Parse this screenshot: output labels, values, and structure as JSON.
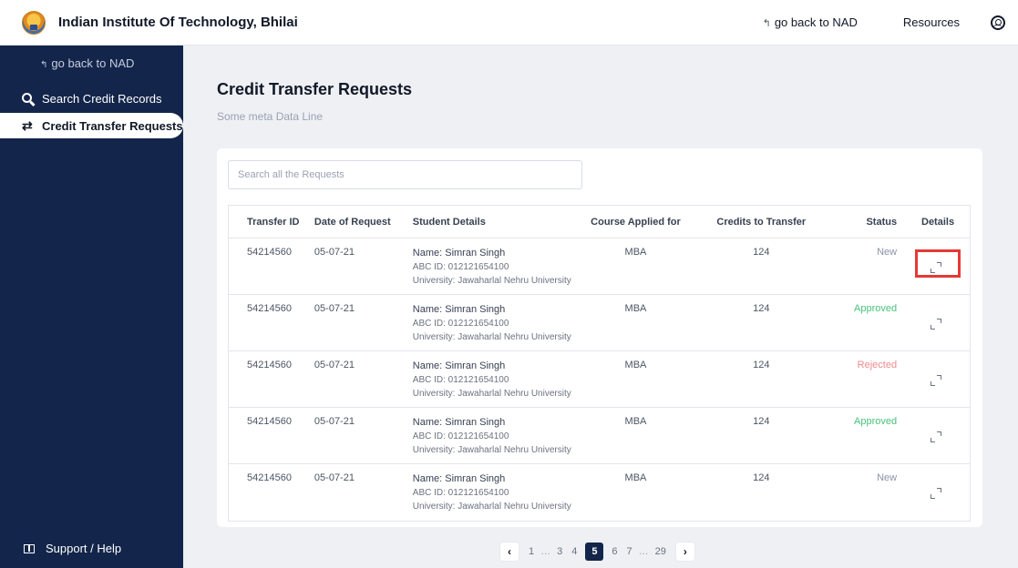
{
  "header": {
    "institute_name": "Indian Institute Of Technology, Bhilai",
    "back_link": "go back to NAD",
    "resources_link": "Resources"
  },
  "sidebar": {
    "back_link": "go back to NAD",
    "items": [
      {
        "label": "Search Credit Records",
        "icon": "search-icon",
        "active": false
      },
      {
        "label": "Credit Transfer Requests",
        "icon": "transfer-arrows-icon",
        "active": true
      }
    ],
    "support_label": "Support / Help"
  },
  "main": {
    "title": "Credit Transfer Requests",
    "meta": "Some meta Data Line",
    "search_placeholder": "Search all the Requests"
  },
  "table": {
    "headers": [
      "Transfer ID",
      "Date of Request",
      "Student Details",
      "Course Applied for",
      "Credits to Transfer",
      "Status",
      "Details"
    ],
    "rows": [
      {
        "id": "54214560",
        "date": "05-07-21",
        "name": "Name: Simran Singh",
        "abc": "ABC ID: 012121654100",
        "university": "University: Jawaharlal Nehru University",
        "course": "MBA",
        "credits": "124",
        "status": "New"
      },
      {
        "id": "54214560",
        "date": "05-07-21",
        "name": "Name: Simran Singh",
        "abc": "ABC ID: 012121654100",
        "university": "University: Jawaharlal Nehru University",
        "course": "MBA",
        "credits": "124",
        "status": "Approved"
      },
      {
        "id": "54214560",
        "date": "05-07-21",
        "name": "Name: Simran Singh",
        "abc": "ABC ID: 012121654100",
        "university": "University: Jawaharlal Nehru University",
        "course": "MBA",
        "credits": "124",
        "status": "Rejected"
      },
      {
        "id": "54214560",
        "date": "05-07-21",
        "name": "Name: Simran Singh",
        "abc": "ABC ID: 012121654100",
        "university": "University: Jawaharlal Nehru University",
        "course": "MBA",
        "credits": "124",
        "status": "Approved"
      },
      {
        "id": "54214560",
        "date": "05-07-21",
        "name": "Name: Simran Singh",
        "abc": "ABC ID: 012121654100",
        "university": "University: Jawaharlal Nehru University",
        "course": "MBA",
        "credits": "124",
        "status": "New"
      }
    ]
  },
  "pagination": {
    "prev": "‹",
    "next": "›",
    "pages": [
      "1",
      "…",
      "3",
      "4",
      "5",
      "6",
      "7",
      "…",
      "29"
    ],
    "current": "5"
  },
  "colors": {
    "sidebar_bg": "#13254a",
    "status_new": "#8a93a6",
    "status_approved": "#49c27a",
    "status_rejected": "#ef8a8a",
    "highlight": "#e53935"
  }
}
